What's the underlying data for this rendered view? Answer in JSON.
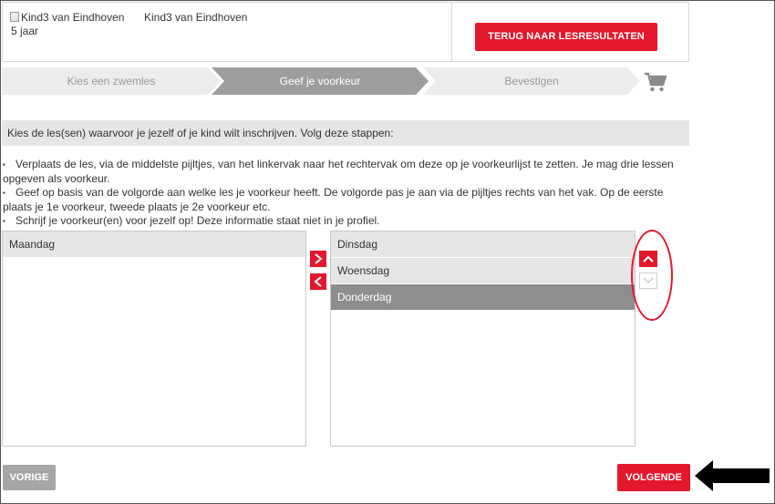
{
  "header": {
    "image_alt": "Kind3 van Eindhoven",
    "kid_name": "Kind3 van Eindhoven",
    "age": "5 jaar",
    "back_button": "TERUG NAAR LESRESULTATEN"
  },
  "steps": [
    {
      "label": "Kies een zwemles",
      "state": "done"
    },
    {
      "label": "Geef je voorkeur",
      "state": "active"
    },
    {
      "label": "Bevestigen",
      "state": "pending"
    }
  ],
  "cart_icon": "shopping-cart-icon",
  "instructions": {
    "heading": "Kies de les(sen) waarvoor je jezelf of je kind wilt inschrijven. Volg deze stappen:",
    "bullets": [
      "Verplaats de les, via de middelste pijltjes, van het linkervak naar het rechtervak om deze op je voorkeurlijst te zetten. Je mag drie lessen opgeven als voorkeur.",
      "Geef op basis van de volgorde aan welke les je voorkeur heeft. De volgorde pas je aan via de pijltjes rechts van het vak. Op de eerste plaats je 1e voorkeur, tweede plaats je 2e voorkeur etc.",
      "Schrijf je voorkeur(en) voor jezelf op! Deze informatie staat niet in je profiel."
    ]
  },
  "available_list": {
    "items": [
      "Maandag"
    ]
  },
  "preference_list": {
    "items": [
      "Dinsdag",
      "Woensdag",
      "Donderdag"
    ],
    "selected": "Donderdag"
  },
  "buttons": {
    "previous": "VORIGE",
    "next": "VOLGENDE"
  },
  "colors": {
    "accent": "#e3182d",
    "active_step": "#9e9e9e",
    "inactive_step": "#ececec",
    "selected_item": "#8e8e8e"
  }
}
